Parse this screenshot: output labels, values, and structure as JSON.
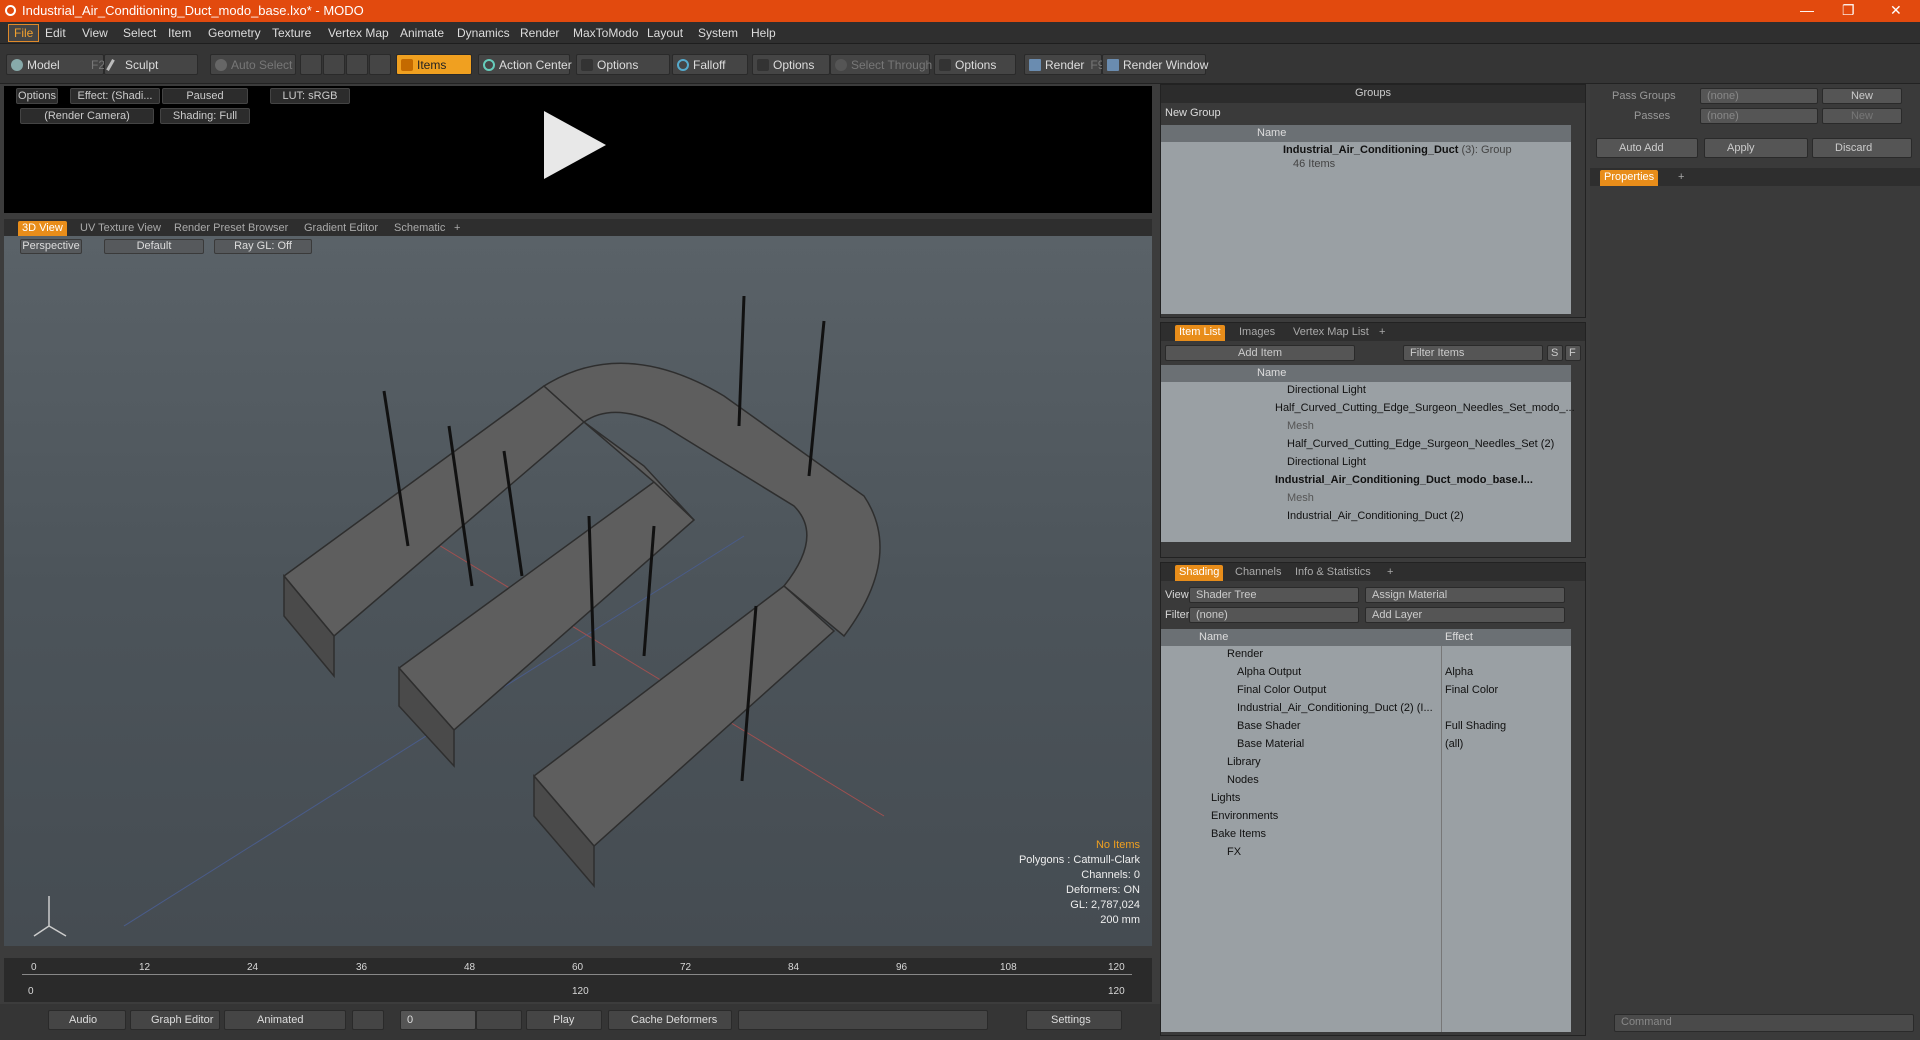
{
  "title": "Industrial_Air_Conditioning_Duct_modo_base.lxo* - MODO",
  "window_controls": {
    "minimize": "—",
    "restore": "❐",
    "close": "✕"
  },
  "menu": [
    "File",
    "Edit",
    "View",
    "Select",
    "Item",
    "Geometry",
    "Texture",
    "Vertex Map",
    "Animate",
    "Dynamics",
    "Render",
    "MaxToModo",
    "Layout",
    "System",
    "Help"
  ],
  "toolbar": {
    "model": "Model",
    "model_key": "F2",
    "sculpt": "Sculpt",
    "auto_select": "Auto Select",
    "items": "Items",
    "action_center": "Action Center",
    "options1": "Options",
    "falloff": "Falloff",
    "options2": "Options",
    "select_through": "Select Through",
    "options3": "Options",
    "render": "Render",
    "render_key": "F9",
    "render_window": "Render Window"
  },
  "preview": {
    "options": "Options",
    "effect": "Effect: (Shadi...",
    "paused": "Paused",
    "lut": "LUT: sRGB",
    "camera": "(Render Camera)",
    "shading": "Shading: Full"
  },
  "viewport_tabs": [
    "3D View",
    "UV Texture View",
    "Render Preset Browser",
    "Gradient Editor",
    "Schematic",
    "+"
  ],
  "viewport": {
    "perspective": "Perspective",
    "default": "Default",
    "raygl": "Ray GL: Off"
  },
  "info": {
    "no_items": "No Items",
    "polygons": "Polygons : Catmull-Clark",
    "channels": "Channels: 0",
    "deformers": "Deformers: ON",
    "gl": "GL: 2,787,024",
    "size": "200 mm"
  },
  "timeline": {
    "ticks": [
      "0",
      "12",
      "24",
      "36",
      "48",
      "60",
      "72",
      "84",
      "96",
      "108",
      "120"
    ],
    "start": "0",
    "mid": "120",
    "end": "120"
  },
  "transport": {
    "audio": "Audio",
    "graph_editor": "Graph Editor",
    "animated": "Animated",
    "frame": "0",
    "play": "Play",
    "cache": "Cache Deformers",
    "settings": "Settings"
  },
  "groups": {
    "title": "Groups",
    "new_group": "New Group",
    "col_name": "Name",
    "item_name": "Industrial_Air_Conditioning_Duct",
    "item_count": "(3)",
    "item_type": ": Group",
    "item_sub": "46 Items"
  },
  "item_list": {
    "tabs": [
      "Item List",
      "Images",
      "Vertex Map List",
      "+"
    ],
    "add_item": "Add Item",
    "filter": "Filter Items",
    "s": "S",
    "f": "F",
    "col_name": "Name",
    "rows": [
      "Directional Light",
      "Half_Curved_Cutting_Edge_Surgeon_Needles_Set_modo_...",
      "Mesh",
      "Half_Curved_Cutting_Edge_Surgeon_Needles_Set (2)",
      "Directional Light",
      "Industrial_Air_Conditioning_Duct_modo_base.l...",
      "Mesh",
      "Industrial_Air_Conditioning_Duct (2)"
    ]
  },
  "shading": {
    "tabs": [
      "Shading",
      "Channels",
      "Info & Statistics",
      "+"
    ],
    "view_label": "View",
    "view_value": "Shader Tree",
    "assign": "Assign Material",
    "filter_label": "Filter",
    "filter_value": "(none)",
    "add_layer": "Add Layer",
    "col_name": "Name",
    "col_effect": "Effect",
    "rows": [
      {
        "name": "Render",
        "effect": ""
      },
      {
        "name": "Alpha Output",
        "effect": "Alpha"
      },
      {
        "name": "Final Color Output",
        "effect": "Final Color"
      },
      {
        "name": "Industrial_Air_Conditioning_Duct (2) (I...",
        "effect": ""
      },
      {
        "name": "Base Shader",
        "effect": "Full Shading"
      },
      {
        "name": "Base Material",
        "effect": "(all)"
      },
      {
        "name": "Library",
        "effect": ""
      },
      {
        "name": "Nodes",
        "effect": ""
      },
      {
        "name": "Lights",
        "effect": ""
      },
      {
        "name": "Environments",
        "effect": ""
      },
      {
        "name": "Bake Items",
        "effect": ""
      },
      {
        "name": "FX",
        "effect": ""
      }
    ]
  },
  "right": {
    "pass_groups": "Pass Groups",
    "passes": "Passes",
    "none": "(none)",
    "new": "New",
    "auto_add": "Auto Add",
    "apply": "Apply",
    "discard": "Discard",
    "properties": "Properties",
    "plus": "+",
    "command": "Command"
  }
}
